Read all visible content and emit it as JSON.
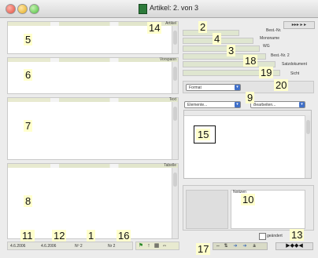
{
  "window": {
    "title": "Artikel: 2. von 3"
  },
  "sections": [
    {
      "label": "Artikel"
    },
    {
      "label": "Vorspann"
    },
    {
      "label": "Text"
    },
    {
      "label": "Tabelle"
    }
  ],
  "fields": [
    {
      "label": "Best.-Nr."
    },
    {
      "label": "Mononame"
    },
    {
      "label": "WG"
    },
    {
      "label": "Best.-Nr. 2"
    },
    {
      "label": "Satzdokument"
    },
    {
      "label": "Sicht"
    }
  ],
  "format_select": {
    "value": "Format"
  },
  "elements_select": {
    "value": "Elemente..."
  },
  "edit_select": {
    "value": "Bearbeiten..."
  },
  "notes": {
    "label": "Notizen"
  },
  "changed": {
    "label": "geändert"
  },
  "status": {
    "date_created": "4.6.2006",
    "date_modified": "4.6.2006",
    "nr1": "Nº 2",
    "nr2": "Nr 2"
  },
  "markers": {
    "m1": "1",
    "m2": "2",
    "m3": "3",
    "m4": "4",
    "m5": "5",
    "m6": "6",
    "m7": "7",
    "m8": "8",
    "m9": "9",
    "m10": "10",
    "m11": "11",
    "m12": "12",
    "m13": "13",
    "m14": "14",
    "m15": "15",
    "m16": "16",
    "m17": "17",
    "m18": "18",
    "m19": "19",
    "m20": "20"
  },
  "colors": {
    "section_strip": "#e2e6cc",
    "field_strip": "#dfe6d0",
    "marker_bg": "#ffffcc",
    "select_arrow": "#3f6fc8"
  }
}
